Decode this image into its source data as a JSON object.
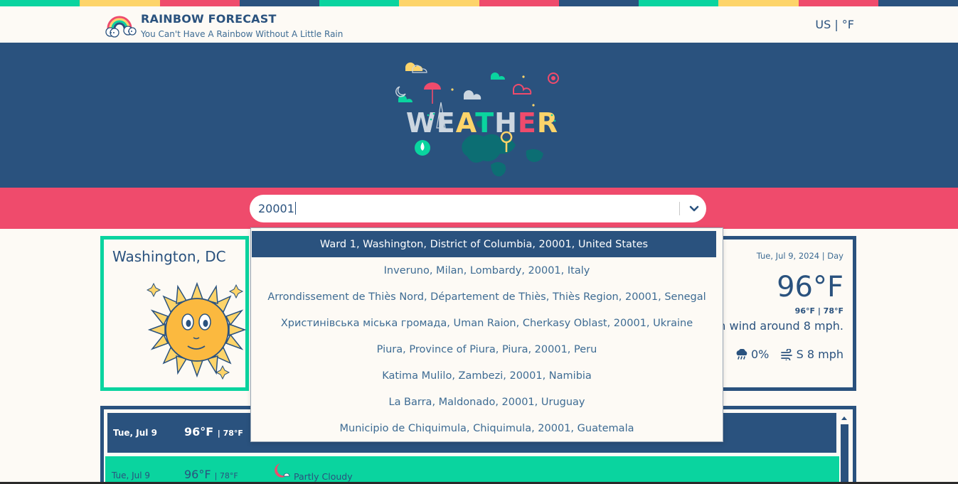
{
  "colors": {
    "navy": "#2a527e",
    "pink": "#ef4b6c",
    "teal": "#0ad49f",
    "yellow": "#fdd46a",
    "cream": "#fdfaf5"
  },
  "rainbow_strip": [
    "#0ad49f",
    "#fdd46a",
    "#ef4b6c",
    "#2a527e",
    "#0ad49f",
    "#fdd46a",
    "#ef4b6c",
    "#2a527e",
    "#0ad49f",
    "#fdd46a",
    "#ef4b6c",
    "#2a527e"
  ],
  "header": {
    "title": "RAINBOW FORECAST",
    "subtitle": "You Can't Have A Rainbow Without A Little Rain",
    "units": "US | °F"
  },
  "hero": {
    "wordmark": "WEATHER"
  },
  "search": {
    "value": "20001",
    "toggle_icon": "chevron-down-icon"
  },
  "dropdown": {
    "options": [
      "Ward 1, Washington, District of Columbia, 20001, United States",
      "Inveruno, Milan, Lombardy, 20001, Italy",
      "Arrondissement de Thiès Nord, Département de Thiès, Thiès Region, 20001, Senegal",
      "Христинівська міська громада, Uman Raion, Cherkasy Oblast, 20001, Ukraine",
      "Piura, Province of Piura, Piura, 20001, Peru",
      "Katima Mulilo, Zambezi, 20001, Namibia",
      "La Barra, Maldonado, 20001, Uruguay",
      "Municipio de Chiquimula, Chiquimula, 20001, Guatemala"
    ],
    "active_index": 0
  },
  "current": {
    "city": "Washington, DC",
    "icon": "sun-icon",
    "date": "Tue, Jul 9, 2024 | Day",
    "temp": "96°F",
    "hilo": "96°F | 78°F",
    "desc_visible": "h wind around 8 mph.",
    "precip": "0%",
    "wind": "S 8 mph"
  },
  "forecast": {
    "rows": [
      {
        "day": "Tue, Jul 9",
        "hi": "96°F",
        "lo": "| 78°F",
        "condition": ""
      },
      {
        "day": "Tue, Jul 9",
        "hi": "96°F",
        "lo": "| 78°F",
        "condition": "Partly Cloudy",
        "icon": "moon-icon"
      }
    ]
  }
}
